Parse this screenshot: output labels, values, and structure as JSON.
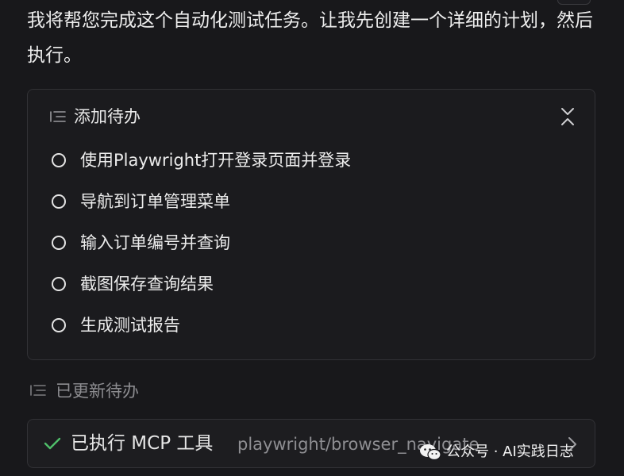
{
  "intro": {
    "text": "我将帮您完成这个自动化测试任务。让我先创建一个详细的计划，然后执行。"
  },
  "todo_card": {
    "title": "添加待办",
    "icon": "list-icon",
    "collapse_icon": "collapse-icon",
    "items": [
      {
        "label": "使用Playwright打开登录页面并登录",
        "done": false
      },
      {
        "label": "导航到订单管理菜单",
        "done": false
      },
      {
        "label": "输入订单编号并查询",
        "done": false
      },
      {
        "label": "截图保存查询结果",
        "done": false
      },
      {
        "label": "生成测试报告",
        "done": false
      }
    ]
  },
  "updated": {
    "text": "已更新待办",
    "icon": "list-icon"
  },
  "mcp": {
    "label": "已执行 MCP 工具",
    "tool": "playwright/browser_navigate",
    "status_icon": "check-icon",
    "expand_icon": "chevron-right-icon"
  },
  "watermark": {
    "text": "公众号 · AI实践日志",
    "icon": "wechat-logo-icon"
  },
  "colors": {
    "background": "#18181b",
    "card_border": "#323236",
    "muted_text": "#8c8c90",
    "success": "#4fbf6a"
  }
}
